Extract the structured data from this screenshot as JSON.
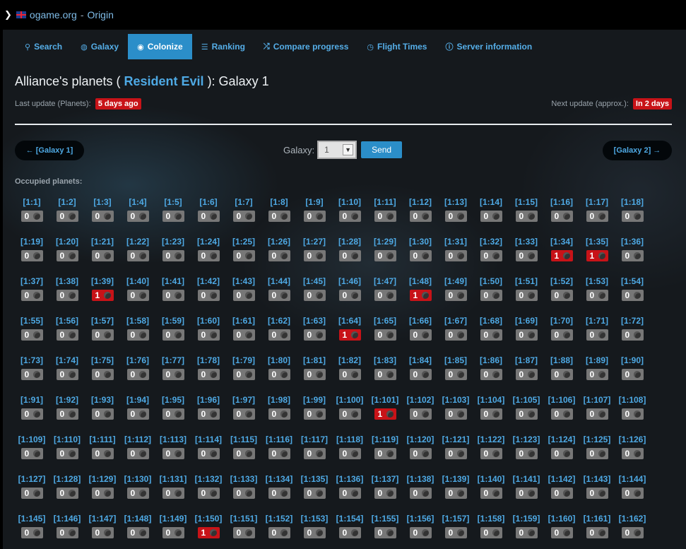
{
  "topbar": {
    "site": "ogame.org",
    "separator": "-",
    "title": "Origin"
  },
  "nav": [
    {
      "label": "Search",
      "icon": "search-icon",
      "glyph": "⚲",
      "active": false
    },
    {
      "label": "Galaxy",
      "icon": "globe-icon",
      "glyph": "◍",
      "active": false
    },
    {
      "label": "Colonize",
      "icon": "pin-icon",
      "glyph": "◉",
      "active": true
    },
    {
      "label": "Ranking",
      "icon": "list-icon",
      "glyph": "☰",
      "active": false
    },
    {
      "label": "Compare progress",
      "icon": "shuffle-icon",
      "glyph": "⤮",
      "active": false
    },
    {
      "label": "Flight Times",
      "icon": "clock-icon",
      "glyph": "◷",
      "active": false
    },
    {
      "label": "Server information",
      "icon": "info-icon",
      "glyph": "ⓘ",
      "active": false
    }
  ],
  "heading": {
    "prefix": "Alliance's planets ( ",
    "alliance": "Resident Evil",
    "suffix": " ): Galaxy 1"
  },
  "last_update": {
    "label": "Last update (Planets):",
    "value": "5 days ago"
  },
  "next_update": {
    "label": "Next update (approx.):",
    "value": "In 2 days"
  },
  "pager": {
    "prev": "← [Galaxy 1]",
    "next": "[Galaxy 2] →"
  },
  "galaxy_form": {
    "label": "Galaxy:",
    "selected": "1",
    "send": "Send"
  },
  "occupied_label": "Occupied planets:",
  "galaxy": 1,
  "systems": {
    "34": 1,
    "35": 1,
    "39": 1,
    "48": 1,
    "64": 1,
    "101": 1,
    "150": 1
  },
  "system_count": 162,
  "columns": 18,
  "colors": {
    "accent": "#4ea9e4",
    "active_tab": "#2b8ec9",
    "alert": "#c81318",
    "zero": "#777777"
  }
}
